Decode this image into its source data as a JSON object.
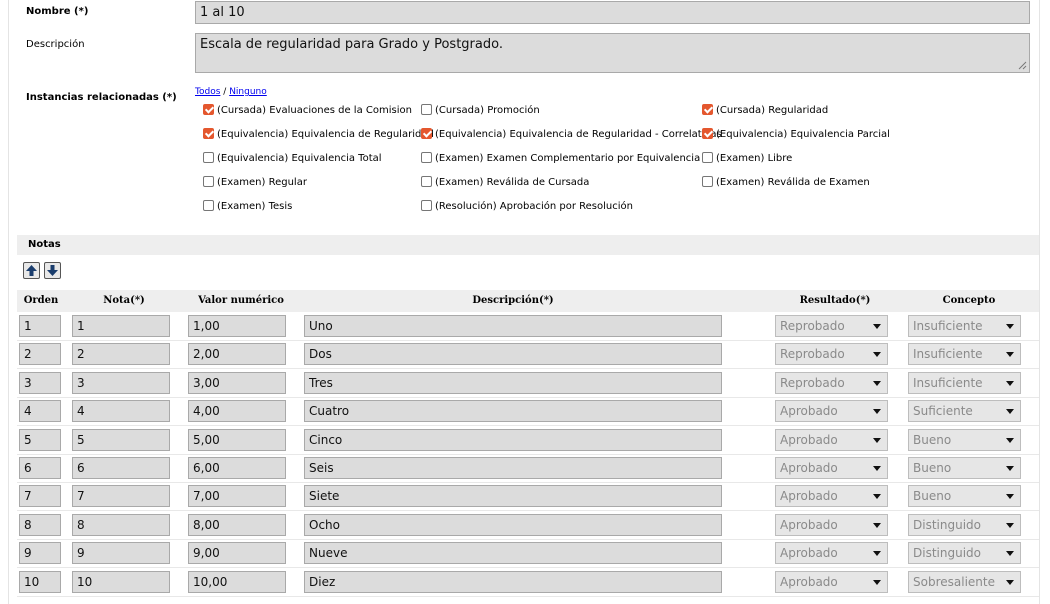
{
  "form": {
    "nombre_label": "Nombre (*)",
    "nombre_value": "1 al 10",
    "descripcion_label": "Descripción",
    "descripcion_value": "Escala de regularidad para Grado y Postgrado.",
    "instancias_label": "Instancias relacionadas (*)",
    "todos_link": "Todos",
    "separator": "/",
    "ninguno_link": "Ninguno"
  },
  "instancias": [
    {
      "label": "(Cursada) Evaluaciones de la Comision",
      "checked": true
    },
    {
      "label": "(Cursada) Promoción",
      "checked": false
    },
    {
      "label": "(Cursada) Regularidad",
      "checked": true
    },
    {
      "label": "(Equivalencia) Equivalencia de Regularidad",
      "checked": true
    },
    {
      "label": "(Equivalencia) Equivalencia de Regularidad - Correlativas",
      "checked": true
    },
    {
      "label": "(Equivalencia) Equivalencia Parcial",
      "checked": true
    },
    {
      "label": "(Equivalencia) Equivalencia Total",
      "checked": false
    },
    {
      "label": "(Examen) Examen Complementario por Equivalencia",
      "checked": false
    },
    {
      "label": "(Examen) Libre",
      "checked": false
    },
    {
      "label": "(Examen) Regular",
      "checked": false
    },
    {
      "label": "(Examen) Reválida de Cursada",
      "checked": false
    },
    {
      "label": "(Examen) Reválida de Examen",
      "checked": false
    },
    {
      "label": "(Examen) Tesis",
      "checked": false
    },
    {
      "label": "(Resolución) Aprobación por Resolución",
      "checked": false
    }
  ],
  "notas": {
    "section_title": "Notas",
    "icons": {
      "up": "arrow-up-icon",
      "down": "arrow-down-icon"
    },
    "columns": {
      "orden": "Orden",
      "nota": "Nota(*)",
      "valor": "Valor numérico",
      "descripcion": "Descripción(*)",
      "resultado": "Resultado(*)",
      "concepto": "Concepto"
    },
    "rows": [
      {
        "orden": "1",
        "nota": "1",
        "valor": "1,00",
        "descripcion": "Uno",
        "resultado": "Reprobado",
        "concepto": "Insuficiente"
      },
      {
        "orden": "2",
        "nota": "2",
        "valor": "2,00",
        "descripcion": "Dos",
        "resultado": "Reprobado",
        "concepto": "Insuficiente"
      },
      {
        "orden": "3",
        "nota": "3",
        "valor": "3,00",
        "descripcion": "Tres",
        "resultado": "Reprobado",
        "concepto": "Insuficiente"
      },
      {
        "orden": "4",
        "nota": "4",
        "valor": "4,00",
        "descripcion": "Cuatro",
        "resultado": "Aprobado",
        "concepto": "Suficiente"
      },
      {
        "orden": "5",
        "nota": "5",
        "valor": "5,00",
        "descripcion": "Cinco",
        "resultado": "Aprobado",
        "concepto": "Bueno"
      },
      {
        "orden": "6",
        "nota": "6",
        "valor": "6,00",
        "descripcion": "Seis",
        "resultado": "Aprobado",
        "concepto": "Bueno"
      },
      {
        "orden": "7",
        "nota": "7",
        "valor": "7,00",
        "descripcion": "Siete",
        "resultado": "Aprobado",
        "concepto": "Bueno"
      },
      {
        "orden": "8",
        "nota": "8",
        "valor": "8,00",
        "descripcion": "Ocho",
        "resultado": "Aprobado",
        "concepto": "Distinguido"
      },
      {
        "orden": "9",
        "nota": "9",
        "valor": "9,00",
        "descripcion": "Nueve",
        "resultado": "Aprobado",
        "concepto": "Distinguido"
      },
      {
        "orden": "10",
        "nota": "10",
        "valor": "10,00",
        "descripcion": "Diez",
        "resultado": "Aprobado",
        "concepto": "Sobresaliente"
      }
    ]
  },
  "colors": {
    "checkbox_checked": "#e4572e",
    "input_bg": "#dcdcdc",
    "header_bg": "#eeeeee",
    "link": "#0000ee"
  }
}
